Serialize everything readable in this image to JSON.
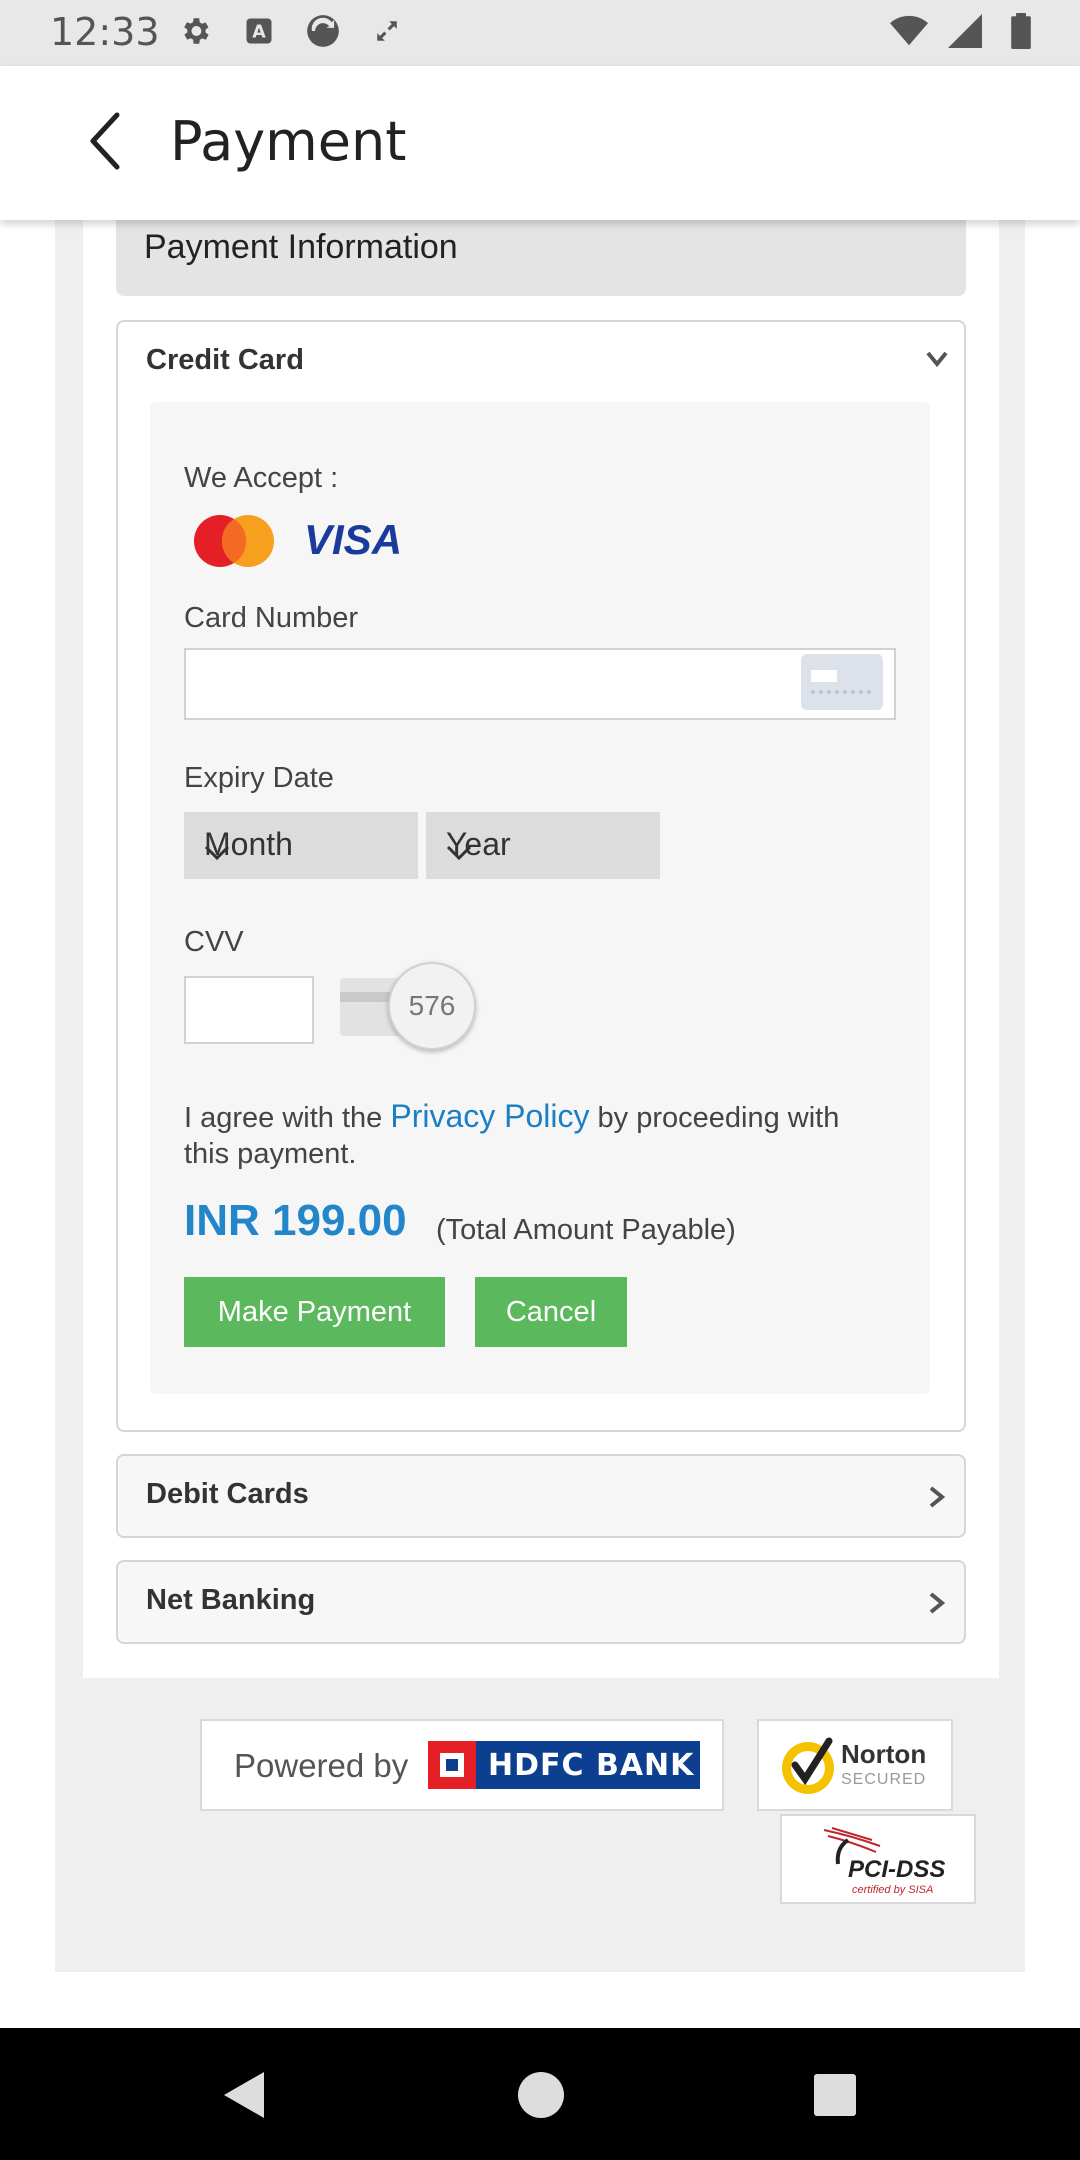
{
  "status_bar": {
    "time": "12:33",
    "icons_left": [
      "gear-icon",
      "keyboard-a-icon",
      "sync-icon",
      "expand-icon"
    ],
    "icons_right": [
      "wifi-icon",
      "signal-icon",
      "battery-icon"
    ]
  },
  "app_bar": {
    "title": "Payment",
    "back_icon": "back-arrow-icon"
  },
  "section": {
    "title": "Payment Information"
  },
  "credit_card": {
    "title": "Credit Card",
    "we_accept_label": "We Accept :",
    "card_logos": [
      "MasterCard",
      "VISA"
    ],
    "card_number_label": "Card Number",
    "card_number_value": "",
    "expiry_label": "Expiry Date",
    "month_select": "Month",
    "year_select": "Year",
    "cvv_label": "CVV",
    "cvv_value": "",
    "cvv_hint_number": "576",
    "agree_prefix": "I agree with the ",
    "agree_link": "Privacy Policy",
    "agree_suffix": " by proceeding with this payment.",
    "amount": "INR 199.00",
    "amount_note": "(Total Amount Payable)",
    "make_payment_label": "Make Payment",
    "cancel_label": "Cancel"
  },
  "debit_cards": {
    "title": "Debit Cards"
  },
  "net_banking": {
    "title": "Net Banking"
  },
  "footer": {
    "powered_by": "Powered by",
    "bank_name": "HDFC BANK",
    "norton_text": "Norton",
    "norton_sub": "SECURED",
    "pci_text": "PCI-DSS",
    "pci_sub": "certified by SISA"
  },
  "colors": {
    "accent_blue": "#2386c8",
    "button_green": "#5cb85c",
    "hdfc_blue": "#0c3f8f",
    "hdfc_red": "#e41f26"
  }
}
